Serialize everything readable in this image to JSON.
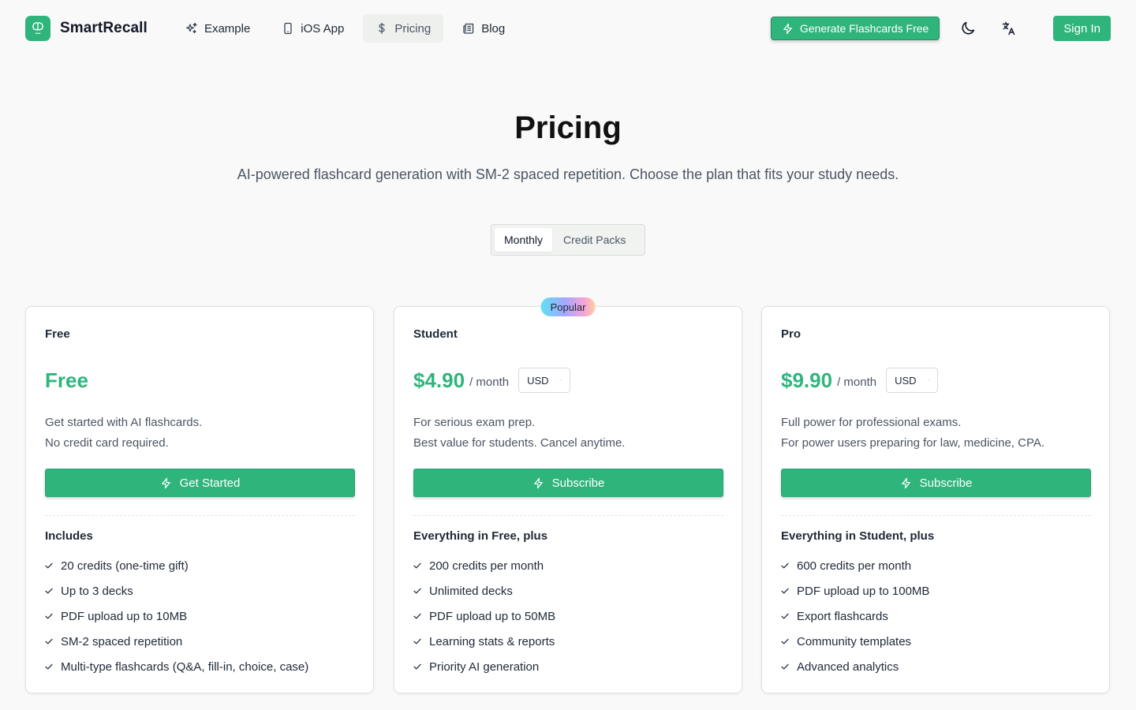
{
  "brand": {
    "name": "SmartRecall",
    "accent": "#2fb57c"
  },
  "nav": {
    "links": [
      {
        "label": "Example",
        "icon": "sparkles-icon"
      },
      {
        "label": "iOS App",
        "icon": "phone-icon"
      },
      {
        "label": "Pricing",
        "icon": "dollar-icon"
      },
      {
        "label": "Blog",
        "icon": "newspaper-icon"
      }
    ],
    "active": "Pricing",
    "generate_label": "Generate Flashcards Free",
    "signin_label": "Sign In"
  },
  "hero": {
    "title": "Pricing",
    "subtitle": "AI-powered flashcard generation with SM-2 spaced repetition. Choose the plan that fits your study needs."
  },
  "billing_toggle": {
    "options": [
      "Monthly",
      "Credit Packs"
    ],
    "selected": "Monthly"
  },
  "plans": [
    {
      "name": "Free",
      "price": "Free",
      "desc_lines": [
        "Get started with AI flashcards.",
        "No credit card required."
      ],
      "cta": "Get Started",
      "features_title": "Includes",
      "features": [
        "20 credits (one-time gift)",
        "Up to 3 decks",
        "PDF upload up to 10MB",
        "SM-2 spaced repetition",
        "Multi-type flashcards (Q&A, fill-in, choice, case)"
      ]
    },
    {
      "name": "Student",
      "badge": "Popular",
      "price": "$4.90",
      "per": "/ month",
      "currency": "USD",
      "desc_lines": [
        "For serious exam prep.",
        "Best value for students. Cancel anytime."
      ],
      "cta": "Subscribe",
      "features_title": "Everything in Free, plus",
      "features": [
        "200 credits per month",
        "Unlimited decks",
        "PDF upload up to 50MB",
        "Learning stats & reports",
        "Priority AI generation"
      ]
    },
    {
      "name": "Pro",
      "price": "$9.90",
      "per": "/ month",
      "currency": "USD",
      "desc_lines": [
        "Full power for professional exams.",
        "For power users preparing for law, medicine, CPA."
      ],
      "cta": "Subscribe",
      "features_title": "Everything in Student, plus",
      "features": [
        "600 credits per month",
        "PDF upload up to 100MB",
        "Export flashcards",
        "Community templates",
        "Advanced analytics"
      ]
    }
  ]
}
